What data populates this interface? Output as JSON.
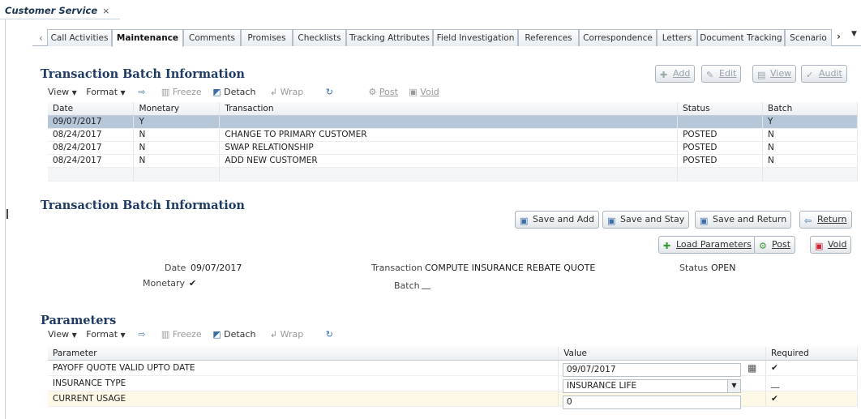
{
  "window_tab": {
    "title": "Customer Service",
    "close": "×"
  },
  "tabs": [
    {
      "label": "Call Activities",
      "active": false
    },
    {
      "label": "Maintenance",
      "active": true
    },
    {
      "label": "Comments",
      "active": false
    },
    {
      "label": "Promises",
      "active": false
    },
    {
      "label": "Checklists",
      "active": false
    },
    {
      "label": "Tracking Attributes",
      "active": false
    },
    {
      "label": "Field Investigation",
      "active": false
    },
    {
      "label": "References",
      "active": false
    },
    {
      "label": "Correspondence",
      "active": false
    },
    {
      "label": "Letters",
      "active": false
    },
    {
      "label": "Document Tracking",
      "active": false
    },
    {
      "label": "Scenario",
      "active": false
    }
  ],
  "batch_section": {
    "title": "Transaction Batch Information",
    "actions": {
      "add": "Add",
      "edit": "Edit",
      "view": "View",
      "audit": "Audit"
    },
    "toolbar": {
      "view": "View",
      "format": "Format",
      "freeze": "Freeze",
      "detach": "Detach",
      "wrap": "Wrap",
      "post": "Post",
      "void": "Void"
    },
    "columns": {
      "date": "Date",
      "monetary": "Monetary",
      "transaction": "Transaction",
      "status": "Status",
      "batch": "Batch"
    },
    "rows": [
      {
        "date": "09/07/2017",
        "monetary": "Y",
        "transaction": "",
        "status": "",
        "batch": "Y"
      },
      {
        "date": "08/24/2017",
        "monetary": "N",
        "transaction": "CHANGE TO PRIMARY CUSTOMER",
        "status": "POSTED",
        "batch": "N"
      },
      {
        "date": "08/24/2017",
        "monetary": "N",
        "transaction": "SWAP RELATIONSHIP",
        "status": "POSTED",
        "batch": "N"
      },
      {
        "date": "08/24/2017",
        "monetary": "N",
        "transaction": "ADD NEW CUSTOMER",
        "status": "POSTED",
        "batch": "N"
      }
    ]
  },
  "detail_section": {
    "title": "Transaction Batch Information",
    "buttons": {
      "save_add": "Save and Add",
      "save_stay": "Save and Stay",
      "save_return": "Save and Return",
      "return": "Return",
      "load_params": "Load Parameters",
      "post": "Post",
      "void": "Void"
    },
    "fields": {
      "date_label": "Date",
      "date_value": "09/07/2017",
      "monetary_label": "Monetary",
      "monetary_value": "✔",
      "transaction_label": "Transaction",
      "transaction_value": "COMPUTE INSURANCE REBATE QUOTE",
      "batch_label": "Batch",
      "batch_value": "__",
      "status_label": "Status",
      "status_value": "OPEN"
    }
  },
  "params_section": {
    "title": "Parameters",
    "toolbar": {
      "view": "View",
      "format": "Format",
      "freeze": "Freeze",
      "detach": "Detach",
      "wrap": "Wrap"
    },
    "columns": {
      "parameter": "Parameter",
      "value": "Value",
      "required": "Required"
    },
    "rows": [
      {
        "parameter": "PAYOFF QUOTE VALID UPTO DATE",
        "value": "09/07/2017",
        "required": "✔"
      },
      {
        "parameter": "INSURANCE TYPE",
        "value": "INSURANCE LIFE",
        "required": "__"
      },
      {
        "parameter": "CURRENT USAGE",
        "value": "0",
        "required": "✔"
      }
    ]
  },
  "colors": {
    "selected_row": "#b6c7da",
    "heading": "#1f3b63",
    "highlight_row": "#fdf9e6"
  }
}
